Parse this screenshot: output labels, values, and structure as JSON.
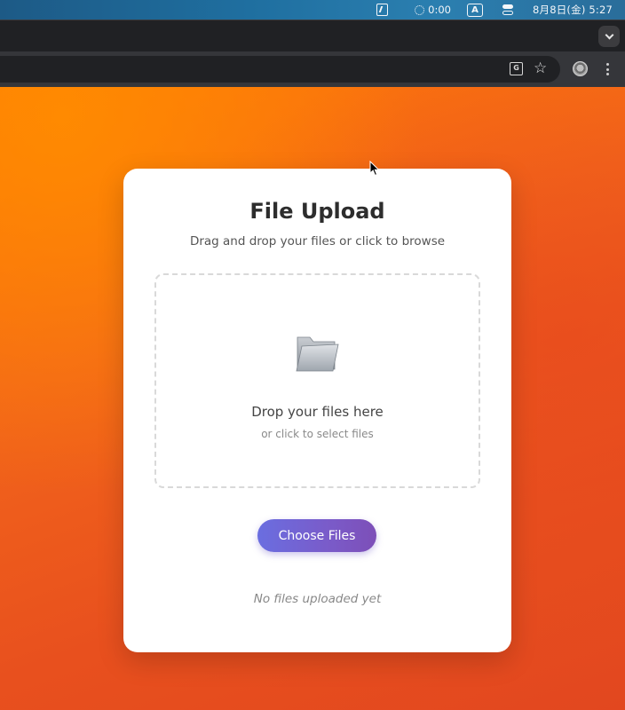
{
  "menubar": {
    "timer": "0:00",
    "input_source": "A",
    "clock": "8月8日(金)  5:27"
  },
  "icons": {
    "battery": "battery-charging-icon",
    "timer": "timer-icon",
    "input": "input-source-icon",
    "control_center": "control-center-icon",
    "tab_search": "chevron-down-icon",
    "translate": "translate-icon",
    "bookmark": "star-icon",
    "profile": "profile-avatar-icon",
    "menu": "kebab-menu-icon",
    "folder": "folder-icon"
  },
  "colors": {
    "background": "#e8501e",
    "button_gradient_start": "#6a6ee0",
    "button_gradient_end": "#7d4fb8"
  },
  "upload": {
    "title": "File Upload",
    "subtitle": "Drag and drop your files or click to browse",
    "drop_title": "Drop your files here",
    "drop_hint": "or click to select files",
    "button_label": "Choose Files",
    "status": "No files uploaded yet"
  }
}
